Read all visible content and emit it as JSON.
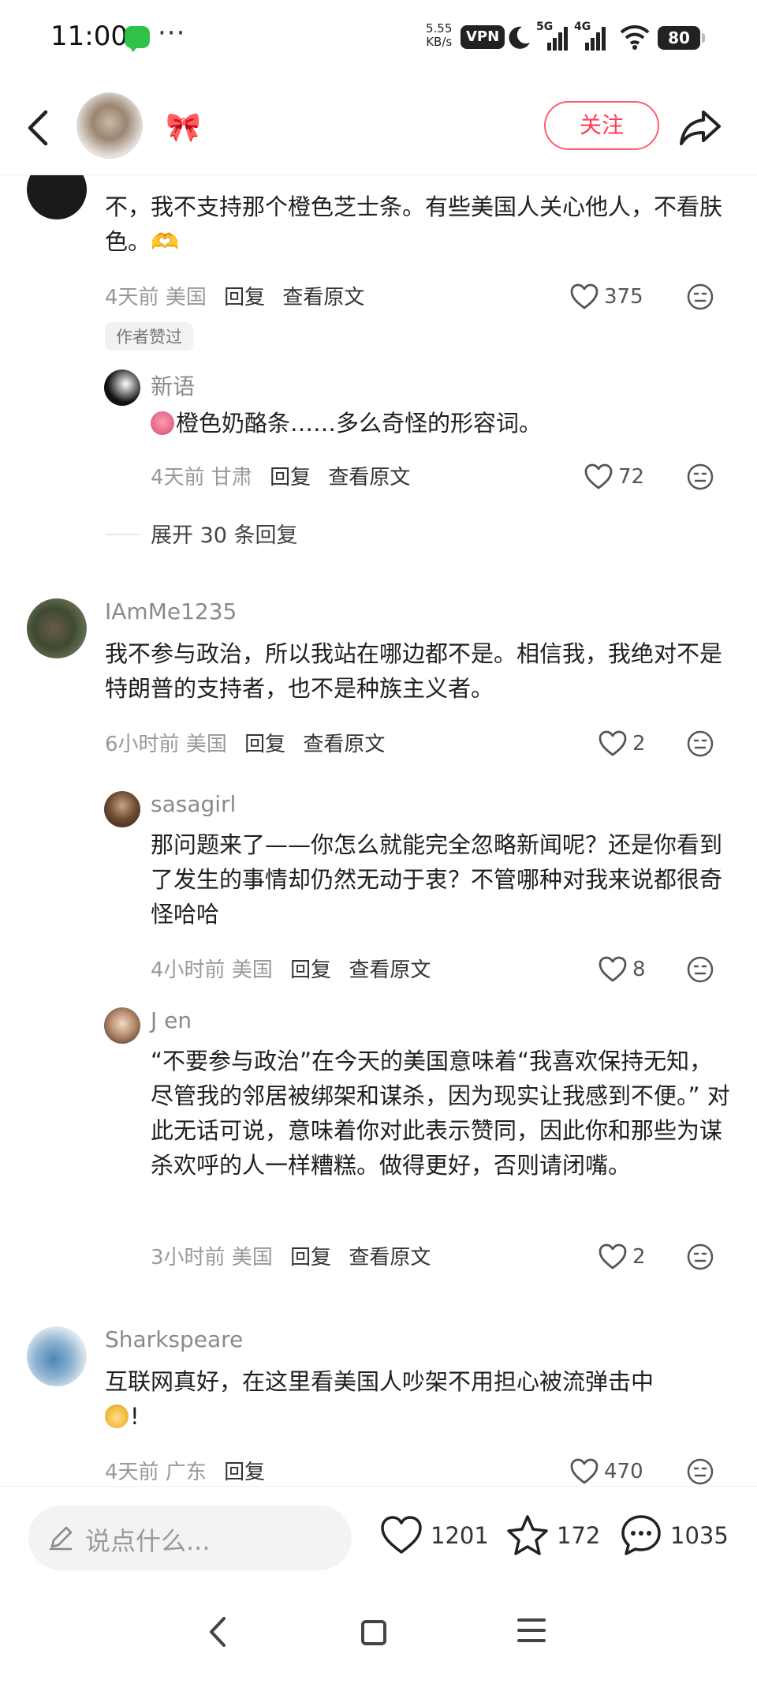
{
  "status_bar": {
    "time": "11:00",
    "dots": "···",
    "net_speed_value": "5.55",
    "net_speed_unit": "KB/s",
    "vpn": "VPN",
    "sig1_label": "5G",
    "sig2_label": "4G",
    "battery": "80"
  },
  "header": {
    "bow_emoji": "🎀",
    "follow_label": "关注",
    "back_icon": "back-chevron-icon",
    "share_icon": "share-arrow-icon"
  },
  "comments": [
    {
      "text": "不，我不支持那个橙色芝士条。有些美国人关心他人，不看肤色。🫶",
      "time": "4天前",
      "location": "美国",
      "reply": "回复",
      "view_original": "查看原文",
      "likes": "375",
      "author_tag": "作者赞过",
      "replies": [
        {
          "username": "新语",
          "text": "橙色奶酪条……多么奇怪的形容词。",
          "time": "4天前",
          "location": "甘肃",
          "reply": "回复",
          "view_original": "查看原文",
          "likes": "72"
        }
      ],
      "expand_label": "展开 30 条回复"
    },
    {
      "username": "IAmMe1235",
      "text": "我不参与政治，所以我站在哪边都不是。相信我，我绝对不是特朗普的支持者，也不是种族主义者。",
      "time": "6小时前",
      "location": "美国",
      "reply": "回复",
      "view_original": "查看原文",
      "likes": "2",
      "replies": [
        {
          "username": "sasagirl",
          "text": "那问题来了——你怎么就能完全忽略新闻呢？还是你看到了发生的事情却仍然无动于衷？不管哪种对我来说都很奇怪哈哈",
          "time": "4小时前",
          "location": "美国",
          "reply": "回复",
          "view_original": "查看原文",
          "likes": "8"
        },
        {
          "username": "J en",
          "text": "“不要参与政治”在今天的美国意味着“我喜欢保持无知，尽管我的邻居被绑架和谋杀，因为现实让我感到不便。” 对此无话可说，意味着你对此表示赞同，因此你和那些为谋杀欢呼的人一样糟糕。做得更好，否则请闭嘴。",
          "time": "3小时前",
          "location": "美国",
          "reply": "回复",
          "view_original": "查看原文",
          "likes": "2"
        }
      ]
    },
    {
      "username": "Sharkspeare",
      "text": "互联网真好，在这里看美国人吵架不用担心被流弹击中",
      "text_tail": "!",
      "time": "4天前",
      "location": "广东",
      "reply": "回复",
      "likes": "470"
    }
  ],
  "bottom_bar": {
    "placeholder": "说点什么...",
    "likes": "1201",
    "favorites": "172",
    "comments": "1035"
  },
  "colors": {
    "accent": "#ff3d56",
    "text_primary": "#1f1f1f",
    "text_secondary": "#999999"
  }
}
